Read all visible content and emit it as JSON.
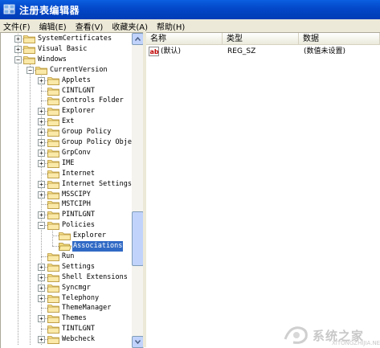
{
  "window": {
    "title": "注册表编辑器"
  },
  "menu": [
    {
      "label": "文件(F)"
    },
    {
      "label": "编辑(E)"
    },
    {
      "label": "查看(V)"
    },
    {
      "label": "收藏夹(A)"
    },
    {
      "label": "帮助(H)"
    }
  ],
  "tree": {
    "items": [
      {
        "label": "SystemCertificates",
        "level": 1,
        "expander": "+"
      },
      {
        "label": "Visual Basic",
        "level": 1,
        "expander": "+"
      },
      {
        "label": "Windows",
        "level": 1,
        "expander": "-"
      },
      {
        "label": "CurrentVersion",
        "level": 2,
        "expander": "-"
      },
      {
        "label": "Applets",
        "level": 3,
        "expander": "+"
      },
      {
        "label": "CINTLGNT",
        "level": 3,
        "expander": ""
      },
      {
        "label": "Controls Folder",
        "level": 3,
        "expander": ""
      },
      {
        "label": "Explorer",
        "level": 3,
        "expander": "+"
      },
      {
        "label": "Ext",
        "level": 3,
        "expander": "+"
      },
      {
        "label": "Group Policy",
        "level": 3,
        "expander": "+"
      },
      {
        "label": "Group Policy Objec",
        "level": 3,
        "expander": "+"
      },
      {
        "label": "GrpConv",
        "level": 3,
        "expander": "+"
      },
      {
        "label": "IME",
        "level": 3,
        "expander": "+"
      },
      {
        "label": "Internet",
        "level": 3,
        "expander": ""
      },
      {
        "label": "Internet Settings",
        "level": 3,
        "expander": "+"
      },
      {
        "label": "MSSCIPY",
        "level": 3,
        "expander": "+"
      },
      {
        "label": "MSTCIPH",
        "level": 3,
        "expander": ""
      },
      {
        "label": "PINTLGNT",
        "level": 3,
        "expander": "+"
      },
      {
        "label": "Policies",
        "level": 3,
        "expander": "-"
      },
      {
        "label": "Explorer",
        "level": 4,
        "expander": ""
      },
      {
        "label": "Associations",
        "level": 4,
        "expander": "",
        "selected": true
      },
      {
        "label": "Run",
        "level": 3,
        "expander": ""
      },
      {
        "label": "Settings",
        "level": 3,
        "expander": "+"
      },
      {
        "label": "Shell Extensions",
        "level": 3,
        "expander": "+"
      },
      {
        "label": "Syncmgr",
        "level": 3,
        "expander": "+"
      },
      {
        "label": "Telephony",
        "level": 3,
        "expander": "+"
      },
      {
        "label": "ThemeManager",
        "level": 3,
        "expander": ""
      },
      {
        "label": "Themes",
        "level": 3,
        "expander": "+"
      },
      {
        "label": "TINTLGNT",
        "level": 3,
        "expander": ""
      },
      {
        "label": "Webcheck",
        "level": 3,
        "expander": "+"
      }
    ]
  },
  "list": {
    "columns": [
      "名称",
      "类型",
      "数据"
    ],
    "rows": [
      {
        "name": "(默认)",
        "type": "REG_SZ",
        "data": "(数值未设置)"
      }
    ]
  },
  "watermark": {
    "text": "系统之家",
    "url": "XITONGZHIJIA.NET"
  },
  "colors": {
    "titlebar": "#0347c8",
    "selection": "#316ac5",
    "chrome": "#ece9d8"
  }
}
